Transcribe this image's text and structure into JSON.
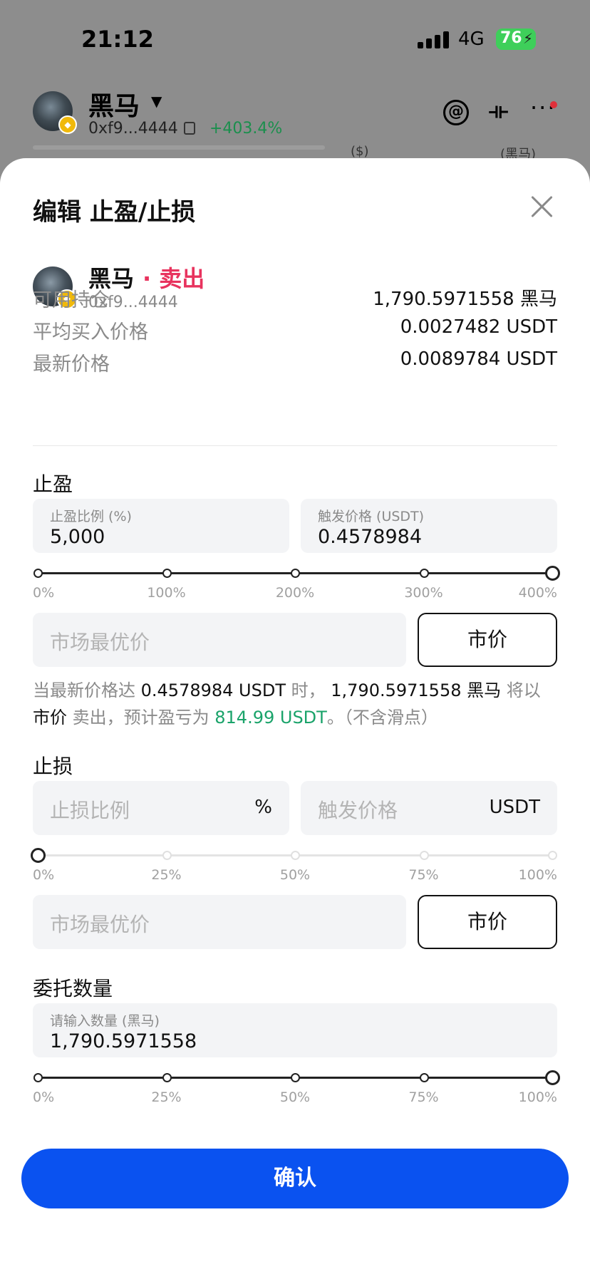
{
  "status_bar": {
    "time": "21:12",
    "network": "4G",
    "battery": "76"
  },
  "background_app": {
    "token_name": "黑马",
    "address": "0xf9...4444",
    "change": "+403.4%",
    "col_usd": "($)",
    "col_token": "(黑马)"
  },
  "sheet": {
    "title": "编辑 止盈/止损",
    "token": {
      "name": "黑马",
      "side": "· 卖出",
      "address": "0xf9...4444"
    },
    "info": [
      {
        "label": "可用持仓",
        "value": "1,790.5971558 黑马"
      },
      {
        "label": "平均买入价格",
        "value": "0.0027482 USDT"
      },
      {
        "label": "最新价格",
        "value": "0.0089784 USDT"
      }
    ],
    "take_profit": {
      "title": "止盈",
      "ratio_label": "止盈比例 (%)",
      "ratio_value": "5,000",
      "trigger_label": "触发价格 (USDT)",
      "trigger_value": "0.4578984",
      "slider_ticks": [
        "0%",
        "100%",
        "200%",
        "300%",
        "400%"
      ],
      "slider_level": 1.0,
      "price_placeholder": "市场最优价",
      "market_label": "市价",
      "desc": {
        "p1": "当最新价格达",
        "price": " 0.4578984 USDT ",
        "p2": "时，",
        "amount": " 1,790.5971558 黑马 ",
        "p3": "将以",
        "type": " 市价 ",
        "p4": "卖出，预计盈亏为",
        "pnl": " 814.99 USDT",
        "p5": "。（不含滑点）"
      }
    },
    "stop_loss": {
      "title": "止损",
      "ratio_placeholder": "止损比例",
      "ratio_unit": "%",
      "trigger_placeholder": "触发价格",
      "trigger_unit": "USDT",
      "slider_ticks": [
        "0%",
        "25%",
        "50%",
        "75%",
        "100%"
      ],
      "slider_level": 0.0,
      "price_placeholder": "市场最优价",
      "market_label": "市价"
    },
    "quantity": {
      "title": "委托数量",
      "label": "请输入数量 (黑马)",
      "value": "1,790.5971558",
      "slider_ticks": [
        "0%",
        "25%",
        "50%",
        "75%",
        "100%"
      ],
      "slider_level": 1.0
    },
    "confirm_label": "确认"
  }
}
